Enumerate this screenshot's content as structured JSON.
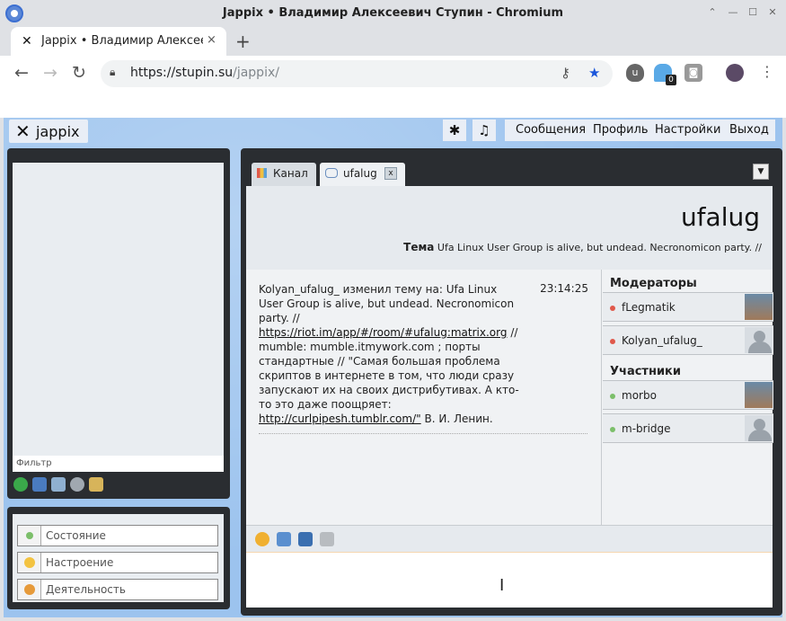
{
  "window": {
    "title": "Jappix • Владимир Алексеевич Ступин - Chromium"
  },
  "tab": {
    "title": "Jappix • Владимир Алексеевич Ступин",
    "close": "×"
  },
  "newtab": "+",
  "address": {
    "scheme_host": "https://stupin.su",
    "path": "/jappix/"
  },
  "extensions": {
    "badge_count": "0"
  },
  "app": {
    "logo_text": "jappix",
    "menu": {
      "messages": "Сообщения",
      "profile": "Профиль",
      "settings": "Настройки",
      "logout": "Выход"
    },
    "roster": {
      "filter_placeholder": "Фильтр"
    },
    "status": {
      "presence": "Состояние",
      "mood": "Настроение",
      "activity": "Деятельность"
    },
    "chat_tabs": {
      "channel": "Канал",
      "room": "ufalug",
      "close": "x"
    },
    "room": {
      "name": "ufalug",
      "topic_label": "Тема",
      "topic": "Ufa Linux User Group is alive, but undead. Necronomicon party. //"
    },
    "message": {
      "time": "23:14:25",
      "part1": "Kolyan_ufalug_ изменил тему на: Ufa Linux User Group is alive, but undead. Necronomicon party. //",
      "link1": "https://riot.im/app/#/room/#ufalug:matrix.org",
      "part2": "// mumble: mumble.itmywork.com ; порты стандартные // \"Самая большая проблема скриптов в интернете в том, что люди сразу запускают их на своих дистрибутивах. А кто-то это даже поощряет:",
      "link2": "http://curlpipesh.tumblr.com/\"",
      "part3": "В. И. Ленин."
    },
    "occupants": {
      "moderators_label": "Модераторы",
      "moderators": [
        "fLegmatik",
        "Kolyan_ufalug_"
      ],
      "participants_label": "Участники",
      "participants": [
        "morbo",
        "m-bridge"
      ]
    }
  },
  "colors": {
    "accent": "#9cc3ee",
    "panel": "#2a2d31",
    "online": "#7cbf6a",
    "busy": "#e0584a"
  }
}
